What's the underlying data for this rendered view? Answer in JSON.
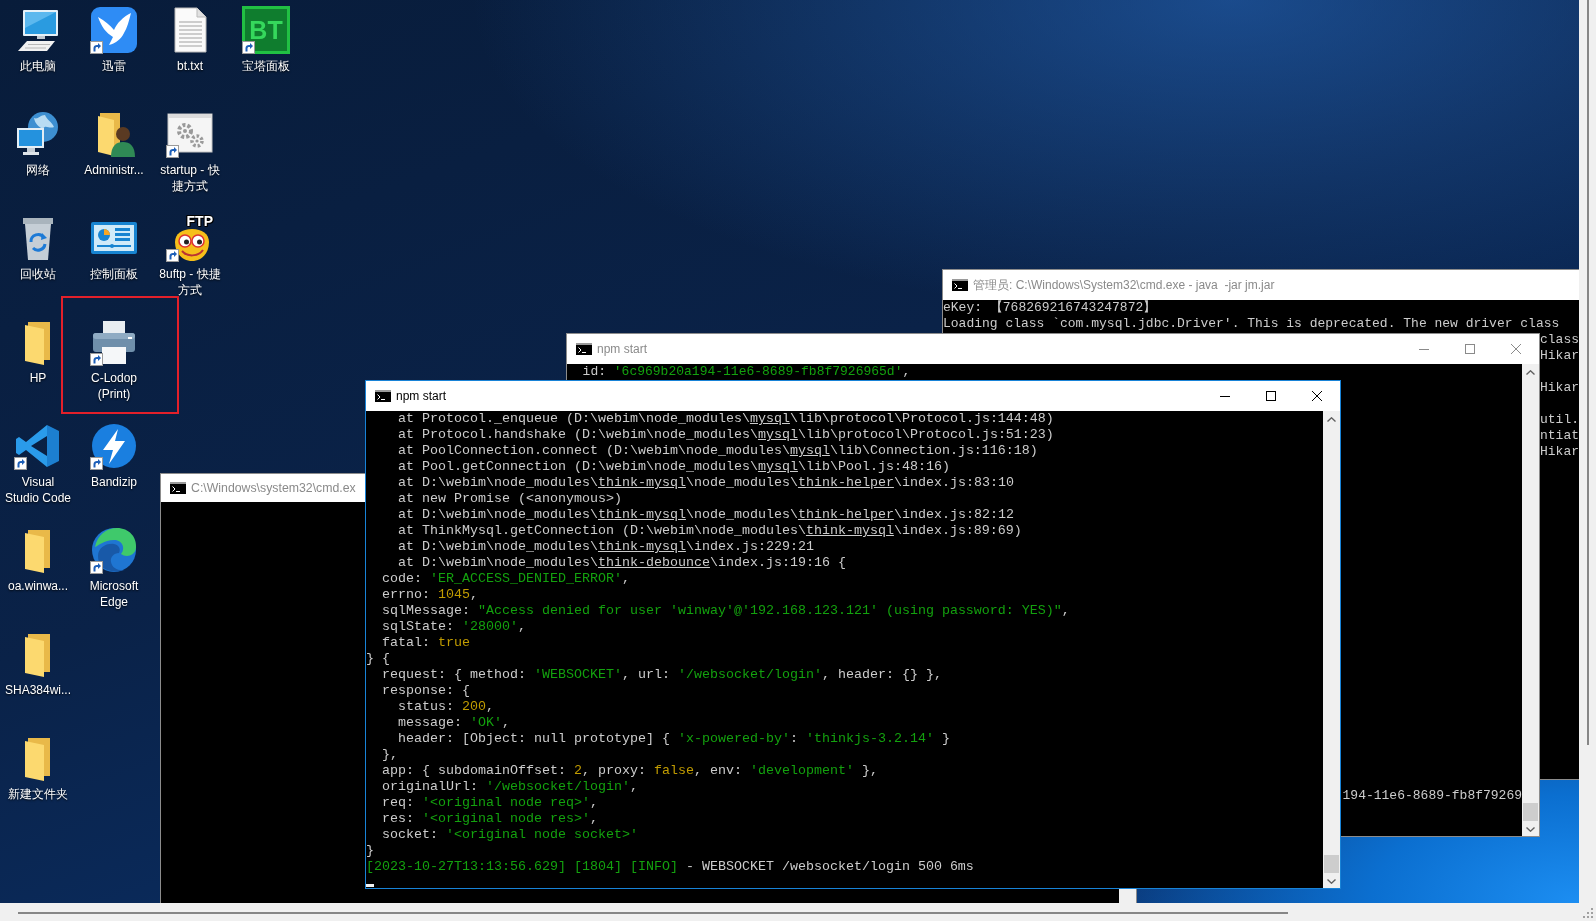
{
  "desktop_columns": [
    {
      "icons": [
        {
          "label": "此电脑",
          "kind": "computer",
          "shortcut": false,
          "highlighted": false
        },
        {
          "label": "网络",
          "kind": "network",
          "shortcut": false,
          "highlighted": false
        },
        {
          "label": "回收站",
          "kind": "recycle-bin",
          "shortcut": false,
          "highlighted": false
        },
        {
          "label": "HP",
          "kind": "folder",
          "shortcut": false,
          "highlighted": false
        },
        {
          "label": "Visual Studio Code",
          "kind": "editor",
          "shortcut": true,
          "highlighted": false
        },
        {
          "label": "oa.winwa...",
          "kind": "folder",
          "shortcut": false,
          "highlighted": false
        },
        {
          "label": "SHA384wi...",
          "kind": "folder",
          "shortcut": false,
          "highlighted": false
        },
        {
          "label": "新建文件夹",
          "kind": "folder",
          "shortcut": false,
          "highlighted": false
        }
      ]
    },
    {
      "icons": [
        {
          "label": "迅雷",
          "kind": "downloader",
          "shortcut": true,
          "highlighted": false
        },
        {
          "label": "Administr...",
          "kind": "user-folder",
          "shortcut": false,
          "highlighted": false
        },
        {
          "label": "控制面板",
          "kind": "control-panel",
          "shortcut": false,
          "highlighted": false
        },
        {
          "label": "C-Lodop (Print)",
          "kind": "printer",
          "shortcut": true,
          "highlighted": true
        },
        {
          "label": "Bandizip",
          "kind": "archiver",
          "shortcut": true,
          "highlighted": false
        },
        {
          "label": "Microsoft Edge",
          "kind": "browser",
          "shortcut": true,
          "highlighted": false
        }
      ]
    },
    {
      "icons": [
        {
          "label": "bt.txt",
          "kind": "text-file",
          "shortcut": false,
          "highlighted": false
        },
        {
          "label": "startup - 快捷方式",
          "kind": "program",
          "shortcut": true,
          "highlighted": false
        },
        {
          "label": "8uftp - 快捷方式",
          "kind": "ftp-client",
          "icon_text": "FTP",
          "shortcut": true,
          "highlighted": false
        }
      ]
    },
    {
      "icons": [
        {
          "label": "宝塔面板",
          "kind": "panel",
          "icon_text": "BT",
          "shortcut": true,
          "highlighted": false
        }
      ]
    }
  ],
  "windows": [
    {
      "title": "管理员: C:\\Windows\\System32\\cmd.exe - java  -jar jm.jar",
      "active": false,
      "caption_buttons": false,
      "scrollbar": false,
      "cursor": false,
      "lines": [
        {
          "kind": "line",
          "segments": [
            {
              "kind": "plain",
              "text": "eKey: 【768269216743247872】"
            }
          ]
        },
        {
          "kind": "line",
          "segments": [
            {
              "kind": "plain",
              "text": "Loading class `com.mysql.jdbc.Driver'. This is deprecated. The new driver class"
            }
          ]
        },
        {
          "kind": "tail",
          "segments": [
            {
              "kind": "plain",
              "text": "class"
            }
          ]
        },
        {
          "kind": "tail",
          "segments": [
            {
              "kind": "plain",
              "text": "Hikar"
            }
          ]
        },
        {
          "kind": "blank"
        },
        {
          "kind": "tail",
          "segments": [
            {
              "kind": "plain",
              "text": "Hikar"
            }
          ]
        },
        {
          "kind": "blank"
        },
        {
          "kind": "tail",
          "segments": [
            {
              "kind": "plain",
              "text": "util."
            }
          ]
        },
        {
          "kind": "tail",
          "segments": [
            {
              "kind": "plain",
              "text": "ntiat"
            }
          ]
        },
        {
          "kind": "tail",
          "segments": [
            {
              "kind": "plain",
              "text": "Hikar"
            }
          ]
        }
      ]
    },
    {
      "title": "C:\\Windows\\system32\\cmd.ex",
      "active": false,
      "cursor": false
    },
    {
      "title": "npm start",
      "active": false,
      "caption_buttons": true,
      "scrollbar": true,
      "cursor": false,
      "lines": [
        {
          "kind": "line",
          "segments": [
            {
              "kind": "plain",
              "text": "  id: "
            },
            {
              "kind": "string",
              "text": "'6c969b20a194-11e6-8689-fb8f7926965d'"
            },
            {
              "kind": "plain",
              "text": ","
            }
          ]
        },
        {
          "kind": "gap"
        },
        {
          "kind": "tail",
          "segments": [
            {
              "kind": "plain",
              "text": "194-11e6-8689-fb8f79269"
            }
          ]
        },
        {
          "kind": "blank"
        },
        {
          "kind": "blank"
        }
      ]
    },
    {
      "title": "npm start",
      "active": true,
      "caption_buttons": true,
      "scrollbar": true,
      "cursor": true,
      "lines": [
        {
          "kind": "line",
          "segments": [
            {
              "kind": "plain",
              "text": "    at Protocol._enqueue (D:\\webim\\node_modules\\"
            },
            {
              "kind": "package",
              "text": "mysql"
            },
            {
              "kind": "plain",
              "text": "\\lib\\protocol\\Protocol.js:144:48)"
            }
          ]
        },
        {
          "kind": "line",
          "segments": [
            {
              "kind": "plain",
              "text": "    at Protocol.handshake (D:\\webim\\node_modules\\"
            },
            {
              "kind": "package",
              "text": "mysql"
            },
            {
              "kind": "plain",
              "text": "\\lib\\protocol\\Protocol.js:51:23)"
            }
          ]
        },
        {
          "kind": "line",
          "segments": [
            {
              "kind": "plain",
              "text": "    at PoolConnection.connect (D:\\webim\\node_modules\\"
            },
            {
              "kind": "package",
              "text": "mysql"
            },
            {
              "kind": "plain",
              "text": "\\lib\\Connection.js:116:18)"
            }
          ]
        },
        {
          "kind": "line",
          "segments": [
            {
              "kind": "plain",
              "text": "    at Pool.getConnection (D:\\webim\\node_modules\\"
            },
            {
              "kind": "package",
              "text": "mysql"
            },
            {
              "kind": "plain",
              "text": "\\lib\\Pool.js:48:16)"
            }
          ]
        },
        {
          "kind": "line",
          "segments": [
            {
              "kind": "plain",
              "text": "    at D:\\webim\\node_modules\\"
            },
            {
              "kind": "package",
              "text": "think-mysql"
            },
            {
              "kind": "plain",
              "text": "\\node_modules\\"
            },
            {
              "kind": "package",
              "text": "think-helper"
            },
            {
              "kind": "plain",
              "text": "\\index.js:83:10"
            }
          ]
        },
        {
          "kind": "line",
          "segments": [
            {
              "kind": "plain",
              "text": "    at new Promise (<anonymous>)"
            }
          ]
        },
        {
          "kind": "line",
          "segments": [
            {
              "kind": "plain",
              "text": "    at D:\\webim\\node_modules\\"
            },
            {
              "kind": "package",
              "text": "think-mysql"
            },
            {
              "kind": "plain",
              "text": "\\node_modules\\"
            },
            {
              "kind": "package",
              "text": "think-helper"
            },
            {
              "kind": "plain",
              "text": "\\index.js:82:12"
            }
          ]
        },
        {
          "kind": "line",
          "segments": [
            {
              "kind": "plain",
              "text": "    at ThinkMysql.getConnection (D:\\webim\\node_modules\\"
            },
            {
              "kind": "package",
              "text": "think-mysql"
            },
            {
              "kind": "plain",
              "text": "\\index.js:89:69)"
            }
          ]
        },
        {
          "kind": "line",
          "segments": [
            {
              "kind": "plain",
              "text": "    at D:\\webim\\node_modules\\"
            },
            {
              "kind": "package",
              "text": "think-mysql"
            },
            {
              "kind": "plain",
              "text": "\\index.js:229:21"
            }
          ]
        },
        {
          "kind": "line",
          "segments": [
            {
              "kind": "plain",
              "text": "    at D:\\webim\\node_modules\\"
            },
            {
              "kind": "package",
              "text": "think-debounce"
            },
            {
              "kind": "plain",
              "text": "\\index.js:19:16 {"
            }
          ]
        },
        {
          "kind": "line",
          "segments": [
            {
              "kind": "plain",
              "text": "  code: "
            },
            {
              "kind": "string",
              "text": "'ER_ACCESS_DENIED_ERROR'"
            },
            {
              "kind": "plain",
              "text": ","
            }
          ]
        },
        {
          "kind": "line",
          "segments": [
            {
              "kind": "plain",
              "text": "  errno: "
            },
            {
              "kind": "number",
              "text": "1045"
            },
            {
              "kind": "plain",
              "text": ","
            }
          ]
        },
        {
          "kind": "line",
          "segments": [
            {
              "kind": "plain",
              "text": "  sqlMessage: "
            },
            {
              "kind": "string",
              "text": "\"Access denied for user 'winway'@'192.168.123.121' (using password: YES)\""
            },
            {
              "kind": "plain",
              "text": ","
            }
          ]
        },
        {
          "kind": "line",
          "segments": [
            {
              "kind": "plain",
              "text": "  sqlState: "
            },
            {
              "kind": "string",
              "text": "'28000'"
            },
            {
              "kind": "plain",
              "text": ","
            }
          ]
        },
        {
          "kind": "line",
          "segments": [
            {
              "kind": "plain",
              "text": "  fatal: "
            },
            {
              "kind": "number",
              "text": "true"
            }
          ]
        },
        {
          "kind": "line",
          "segments": [
            {
              "kind": "plain",
              "text": "} {"
            }
          ]
        },
        {
          "kind": "line",
          "segments": [
            {
              "kind": "plain",
              "text": "  request: { method: "
            },
            {
              "kind": "string",
              "text": "'WEBSOCKET'"
            },
            {
              "kind": "plain",
              "text": ", url: "
            },
            {
              "kind": "string",
              "text": "'/websocket/login'"
            },
            {
              "kind": "plain",
              "text": ", header: {} },"
            }
          ]
        },
        {
          "kind": "line",
          "segments": [
            {
              "kind": "plain",
              "text": "  response: {"
            }
          ]
        },
        {
          "kind": "line",
          "segments": [
            {
              "kind": "plain",
              "text": "    status: "
            },
            {
              "kind": "number",
              "text": "200"
            },
            {
              "kind": "plain",
              "text": ","
            }
          ]
        },
        {
          "kind": "line",
          "segments": [
            {
              "kind": "plain",
              "text": "    message: "
            },
            {
              "kind": "string",
              "text": "'OK'"
            },
            {
              "kind": "plain",
              "text": ","
            }
          ]
        },
        {
          "kind": "line",
          "segments": [
            {
              "kind": "plain",
              "text": "    header: [Object: null prototype] { "
            },
            {
              "kind": "string",
              "text": "'x-powered-by'"
            },
            {
              "kind": "plain",
              "text": ": "
            },
            {
              "kind": "string",
              "text": "'thinkjs-3.2.14'"
            },
            {
              "kind": "plain",
              "text": " }"
            }
          ]
        },
        {
          "kind": "line",
          "segments": [
            {
              "kind": "plain",
              "text": "  },"
            }
          ]
        },
        {
          "kind": "line",
          "segments": [
            {
              "kind": "plain",
              "text": "  app: { subdomainOffset: "
            },
            {
              "kind": "number",
              "text": "2"
            },
            {
              "kind": "plain",
              "text": ", proxy: "
            },
            {
              "kind": "number",
              "text": "false"
            },
            {
              "kind": "plain",
              "text": ", env: "
            },
            {
              "kind": "string",
              "text": "'development'"
            },
            {
              "kind": "plain",
              "text": " },"
            }
          ]
        },
        {
          "kind": "line",
          "segments": [
            {
              "kind": "plain",
              "text": "  originalUrl: "
            },
            {
              "kind": "string",
              "text": "'/websocket/login'"
            },
            {
              "kind": "plain",
              "text": ","
            }
          ]
        },
        {
          "kind": "line",
          "segments": [
            {
              "kind": "plain",
              "text": "  req: "
            },
            {
              "kind": "string",
              "text": "'<original node req>'"
            },
            {
              "kind": "plain",
              "text": ","
            }
          ]
        },
        {
          "kind": "line",
          "segments": [
            {
              "kind": "plain",
              "text": "  res: "
            },
            {
              "kind": "string",
              "text": "'<original node res>'"
            },
            {
              "kind": "plain",
              "text": ","
            }
          ]
        },
        {
          "kind": "line",
          "segments": [
            {
              "kind": "plain",
              "text": "  socket: "
            },
            {
              "kind": "string",
              "text": "'<original node socket>'"
            }
          ]
        },
        {
          "kind": "line",
          "segments": [
            {
              "kind": "plain",
              "text": "}"
            }
          ]
        },
        {
          "kind": "line",
          "segments": [
            {
              "kind": "info",
              "text": "[2023-10-27T13:13:56.629] [1804] [INFO]"
            },
            {
              "kind": "plain",
              "text": " - WEBSOCKET /websocket/login 500 6ms"
            }
          ]
        }
      ]
    }
  ]
}
